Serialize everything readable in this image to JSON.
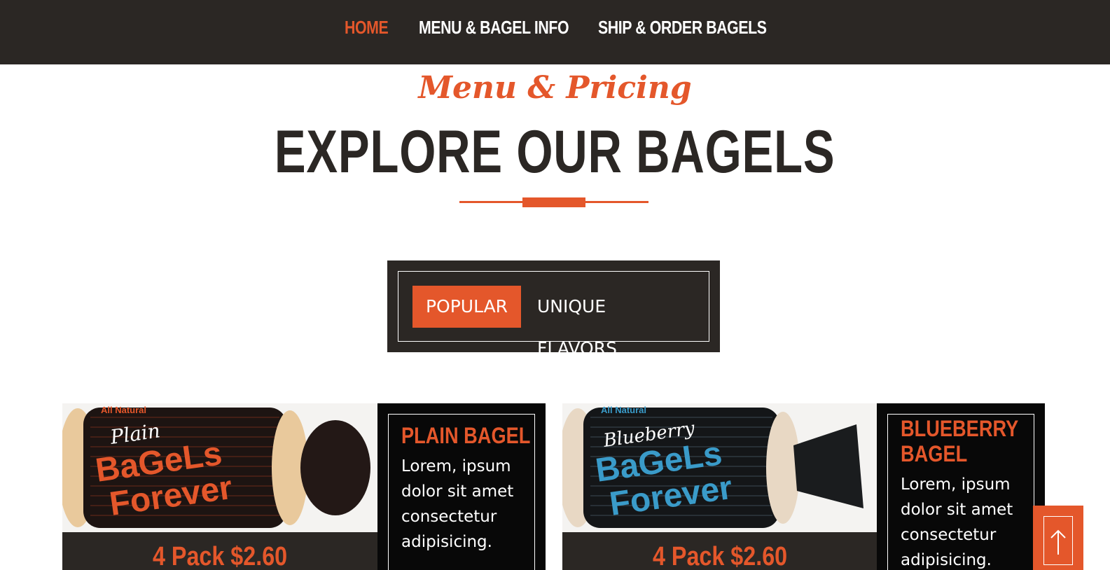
{
  "nav": {
    "items": [
      {
        "label": "HOME",
        "active": true
      },
      {
        "label": "MENU & BAGEL INFO",
        "active": false
      },
      {
        "label": "SHIP & ORDER BAGELS",
        "active": false
      }
    ]
  },
  "section": {
    "script_title": "Menu & Pricing",
    "title": "EXPLORE OUR BAGELS"
  },
  "tabs": [
    {
      "label": "POPULAR",
      "active": true
    },
    {
      "label": "UNIQUE FLAVORS",
      "active": false
    }
  ],
  "products": [
    {
      "name": "PLAIN BAGEL",
      "description": "Lorem, ipsum dolor sit amet consectetur adipisicing.",
      "price": "4 Pack $2.60",
      "bag_flavor": "Plain",
      "bag_brand_line1": "BaGeLs",
      "bag_brand_line2": "Forever",
      "bag_header": "All Natural",
      "bag_color": "#e4572b"
    },
    {
      "name": "BLUEBERRY BAGEL",
      "description": "Lorem, ipsum dolor sit amet consectetur adipisicing.",
      "price": "4 Pack $2.60",
      "bag_flavor": "Blueberry",
      "bag_brand_line1": "BaGeLs",
      "bag_brand_line2": "Forever",
      "bag_header": "All Natural",
      "bag_color": "#3a9bc9"
    }
  ],
  "colors": {
    "accent": "#e4572b",
    "dark": "#2b2724"
  },
  "icons": {
    "back_to_top": "arrow-up-icon"
  }
}
